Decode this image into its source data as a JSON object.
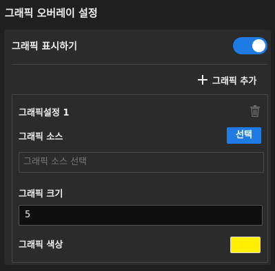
{
  "panel": {
    "title": "그래픽 오버레이 설정",
    "show_label": "그래픽 표시하기",
    "show_enabled": true,
    "add_label": "그래픽 추가"
  },
  "graphic": {
    "name": "그래픽설정 1",
    "source_label": "그래픽 소스",
    "select_label": "선택",
    "source_placeholder": "그래픽 소스 선택",
    "source_value": "",
    "size_label": "그래픽 크기",
    "size_value": "5",
    "color_label": "그래픽 색상",
    "color_value": "#ffee00"
  },
  "colors": {
    "accent": "#1e7be3",
    "background": "#1f1f1f",
    "panel": "#2b2b2b"
  },
  "icons": {
    "add": "plus-icon",
    "delete": "trash-icon"
  }
}
